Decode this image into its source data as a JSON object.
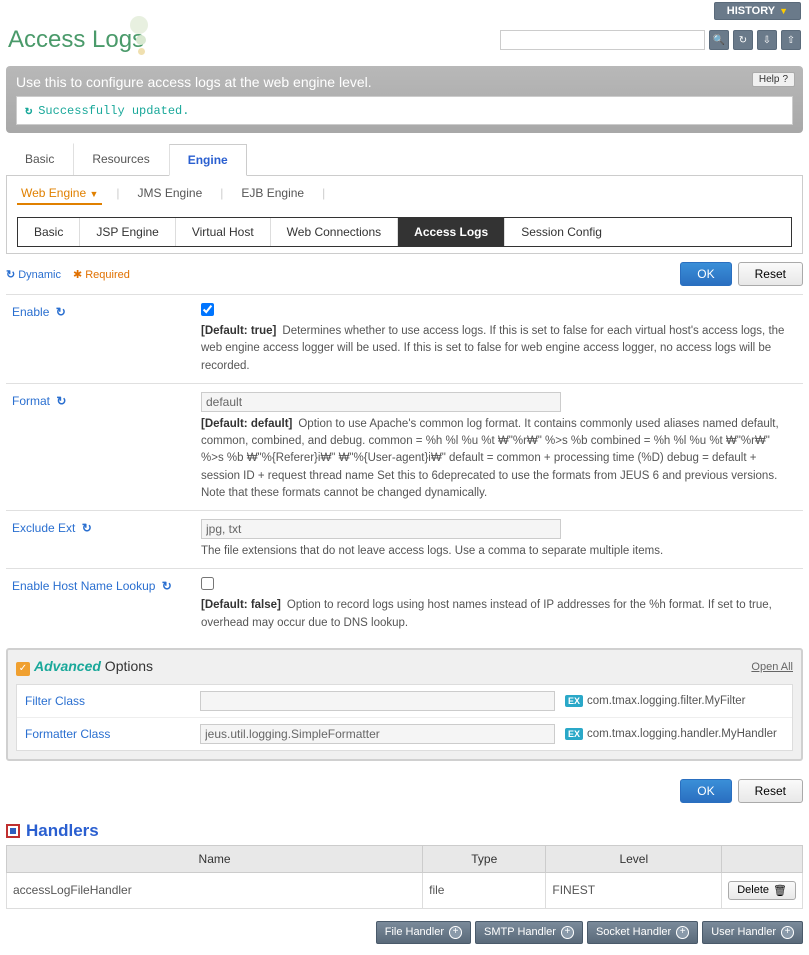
{
  "history_btn": "HISTORY",
  "page_title": "Access Logs",
  "search": {
    "placeholder": ""
  },
  "banner_text": "Use this to configure access logs at the web engine level.",
  "help_label": "Help",
  "status_message": "Successfully updated.",
  "tabs_main": {
    "basic": "Basic",
    "resources": "Resources",
    "engine": "Engine"
  },
  "sub_nav1": {
    "web": "Web Engine",
    "jms": "JMS Engine",
    "ejb": "EJB Engine"
  },
  "sub_nav2": {
    "basic": "Basic",
    "jsp": "JSP Engine",
    "vh": "Virtual Host",
    "wc": "Web Connections",
    "al": "Access Logs",
    "sc": "Session Config"
  },
  "legend": {
    "dynamic": "Dynamic",
    "required": "Required"
  },
  "buttons": {
    "ok": "OK",
    "reset": "Reset",
    "delete": "Delete",
    "open_all": "Open All"
  },
  "fields": {
    "enable": {
      "label": "Enable",
      "checked": true,
      "def": "[Default: true]",
      "desc": "Determines whether to use access logs. If this is set to false for each virtual host's access logs, the web engine access logger will be used. If this is set to false for web engine access logger, no access logs will be recorded."
    },
    "format": {
      "label": "Format",
      "value": "default",
      "def": "[Default: default]",
      "desc": "Option to use Apache's common log format. It contains commonly used aliases named default, common, combined, and debug. common = %h %l %u %t ₩\"%r₩\" %>s %b combined = %h %l %u %t ₩\"%r₩\" %>s %b ₩\"%{Referer}i₩\" ₩\"%{User-agent}i₩\" default = common + processing time (%D) debug = default + session ID + request thread name Set this to 6deprecated to use the formats from JEUS 6 and previous versions. Note that these formats cannot be changed dynamically."
    },
    "exclude_ext": {
      "label": "Exclude Ext",
      "value": "jpg, txt",
      "desc": "The file extensions that do not leave access logs. Use a comma to separate multiple items."
    },
    "hostlookup": {
      "label": "Enable Host Name Lookup",
      "checked": false,
      "def": "[Default: false]",
      "desc": "Option to record logs using host names instead of IP addresses for the %h format. If set to true, overhead may occur due to DNS lookup."
    }
  },
  "advanced": {
    "title_em": "Advanced",
    "title_rest": " Options",
    "filter": {
      "label": "Filter Class",
      "value": "",
      "example": "com.tmax.logging.filter.MyFilter"
    },
    "formatter": {
      "label": "Formatter Class",
      "value": "jeus.util.logging.SimpleFormatter",
      "example": "com.tmax.logging.handler.MyHandler"
    },
    "ex_badge": "EX"
  },
  "handlers": {
    "title": "Handlers",
    "cols": {
      "name": "Name",
      "type": "Type",
      "level": "Level"
    },
    "rows": [
      {
        "name": "accessLogFileHandler",
        "type": "file",
        "level": "FINEST"
      }
    ]
  },
  "footer": {
    "file": "File Handler",
    "smtp": "SMTP Handler",
    "socket": "Socket Handler",
    "user": "User Handler"
  }
}
